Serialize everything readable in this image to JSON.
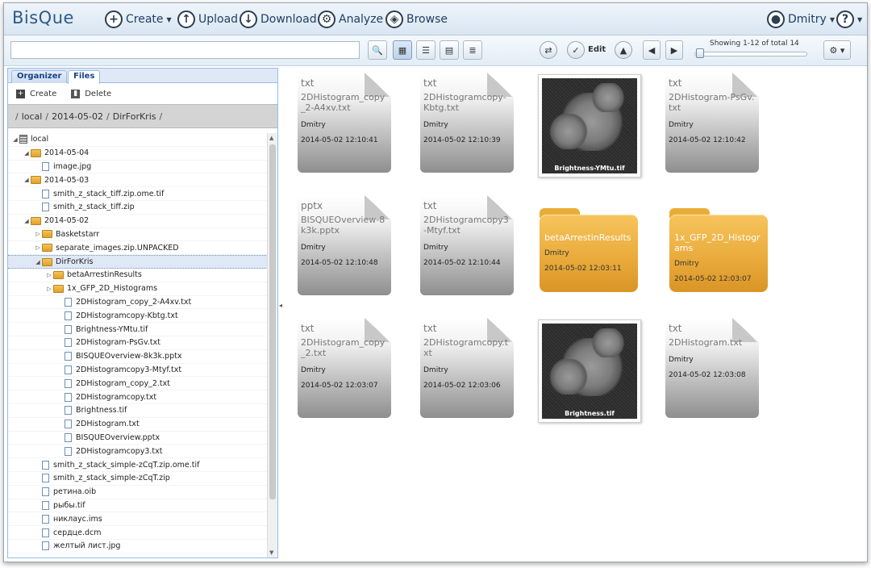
{
  "header": {
    "brand": "BisQue",
    "create": "Create",
    "upload": "Upload",
    "download": "Download",
    "analyze": "Analyze",
    "browse": "Browse",
    "user": "Dmitry",
    "help": "?"
  },
  "toolbar": {
    "search_value": "",
    "edit": "Edit",
    "showing": "Showing 1-12 of total 14"
  },
  "left": {
    "tabs": [
      "Organizer",
      "Files"
    ],
    "create": "Create",
    "delete": "Delete",
    "path": [
      "local",
      "2014-05-02",
      "DirForKris"
    ],
    "tree": [
      {
        "label": "local",
        "type": "db",
        "depth": 0,
        "toggle": "open"
      },
      {
        "label": "2014-05-04",
        "type": "folder",
        "depth": 1,
        "toggle": "open"
      },
      {
        "label": "image.jpg",
        "type": "file",
        "depth": 2,
        "toggle": ""
      },
      {
        "label": "2014-05-03",
        "type": "folder",
        "depth": 1,
        "toggle": "open"
      },
      {
        "label": "smith_z_stack_tiff.zip.ome.tif",
        "type": "file",
        "depth": 2,
        "toggle": ""
      },
      {
        "label": "smith_z_stack_tiff.zip",
        "type": "file",
        "depth": 2,
        "toggle": ""
      },
      {
        "label": "2014-05-02",
        "type": "folder",
        "depth": 1,
        "toggle": "open"
      },
      {
        "label": "Basketstarr",
        "type": "folder",
        "depth": 2,
        "toggle": "closed"
      },
      {
        "label": "separate_images.zip.UNPACKED",
        "type": "folder",
        "depth": 2,
        "toggle": "closed"
      },
      {
        "label": "DirForKris",
        "type": "folder",
        "depth": 2,
        "toggle": "open",
        "selected": true
      },
      {
        "label": "betaArrestinResults",
        "type": "folder",
        "depth": 3,
        "toggle": "closed"
      },
      {
        "label": "1x_GFP_2D_Histograms",
        "type": "folder",
        "depth": 3,
        "toggle": "closed"
      },
      {
        "label": "2DHistogram_copy_2-A4xv.txt",
        "type": "file",
        "depth": 4,
        "toggle": ""
      },
      {
        "label": "2DHistogramcopy-Kbtg.txt",
        "type": "file",
        "depth": 4,
        "toggle": ""
      },
      {
        "label": "Brightness-YMtu.tif",
        "type": "file",
        "depth": 4,
        "toggle": ""
      },
      {
        "label": "2DHistogram-PsGv.txt",
        "type": "file",
        "depth": 4,
        "toggle": ""
      },
      {
        "label": "BISQUEOverview-8k3k.pptx",
        "type": "file",
        "depth": 4,
        "toggle": ""
      },
      {
        "label": "2DHistogramcopy3-Mtyf.txt",
        "type": "file",
        "depth": 4,
        "toggle": ""
      },
      {
        "label": "2DHistogram_copy_2.txt",
        "type": "file",
        "depth": 4,
        "toggle": ""
      },
      {
        "label": "2DHistogramcopy.txt",
        "type": "file",
        "depth": 4,
        "toggle": ""
      },
      {
        "label": "Brightness.tif",
        "type": "file",
        "depth": 4,
        "toggle": ""
      },
      {
        "label": "2DHistogram.txt",
        "type": "file",
        "depth": 4,
        "toggle": ""
      },
      {
        "label": "BISQUEOverview.pptx",
        "type": "file",
        "depth": 4,
        "toggle": ""
      },
      {
        "label": "2DHistogramcopy3.txt",
        "type": "file",
        "depth": 4,
        "toggle": ""
      },
      {
        "label": "smith_z_stack_simple-zCqT.zip.ome.tif",
        "type": "file",
        "depth": 2,
        "toggle": ""
      },
      {
        "label": "smith_z_stack_simple-zCqT.zip",
        "type": "file",
        "depth": 2,
        "toggle": ""
      },
      {
        "label": "ретина.oib",
        "type": "file",
        "depth": 2,
        "toggle": ""
      },
      {
        "label": "рыбы.tif",
        "type": "file",
        "depth": 2,
        "toggle": ""
      },
      {
        "label": "никлаус.ims",
        "type": "file",
        "depth": 2,
        "toggle": ""
      },
      {
        "label": "сердце.dcm",
        "type": "file",
        "depth": 2,
        "toggle": ""
      },
      {
        "label": "желтый лист.jpg",
        "type": "file",
        "depth": 2,
        "toggle": ""
      }
    ]
  },
  "grid": [
    {
      "kind": "doc",
      "ext": "txt",
      "name": "2DHistogram_copy_2-A4xv.txt",
      "owner": "Dmitry",
      "date": "2014-05-02 12:10:41"
    },
    {
      "kind": "doc",
      "ext": "txt",
      "name": "2DHistogramcopy-Kbtg.txt",
      "owner": "Dmitry",
      "date": "2014-05-02 12:10:39"
    },
    {
      "kind": "image",
      "name": "Brightness-YMtu.tif"
    },
    {
      "kind": "doc",
      "ext": "txt",
      "name": "2DHistogram-PsGv.txt",
      "owner": "Dmitry",
      "date": "2014-05-02 12:10:42"
    },
    {
      "kind": "doc",
      "ext": "pptx",
      "name": "BISQUEOverview-8k3k.pptx",
      "owner": "Dmitry",
      "date": "2014-05-02 12:10:48"
    },
    {
      "kind": "doc",
      "ext": "txt",
      "name": "2DHistogramcopy3-Mtyf.txt",
      "owner": "Dmitry",
      "date": "2014-05-02 12:10:44"
    },
    {
      "kind": "folder",
      "name": "betaArrestinResults",
      "owner": "Dmitry",
      "date": "2014-05-02 12:03:11"
    },
    {
      "kind": "folder",
      "name": "1x_GFP_2D_Histograms",
      "owner": "Dmitry",
      "date": "2014-05-02 12:03:07"
    },
    {
      "kind": "doc",
      "ext": "txt",
      "name": "2DHistogram_copy_2.txt",
      "owner": "Dmitry",
      "date": "2014-05-02 12:03:07"
    },
    {
      "kind": "doc",
      "ext": "txt",
      "name": "2DHistogramcopy.txt",
      "owner": "Dmitry",
      "date": "2014-05-02 12:03:06"
    },
    {
      "kind": "image",
      "name": "Brightness.tif"
    },
    {
      "kind": "doc",
      "ext": "txt",
      "name": "2DHistogram.txt",
      "owner": "Dmitry",
      "date": "2014-05-02 12:03:08"
    }
  ],
  "icons": {
    "create": "plus-circle-icon",
    "upload": "upload-icon",
    "download": "download-icon",
    "analyze": "gear-icon",
    "browse": "layers-icon",
    "user": "user-icon",
    "help": "help-icon"
  },
  "colors": {
    "brand": "#2e5a86",
    "folder": "#e9a93a",
    "selection": "#dfe8f6"
  }
}
